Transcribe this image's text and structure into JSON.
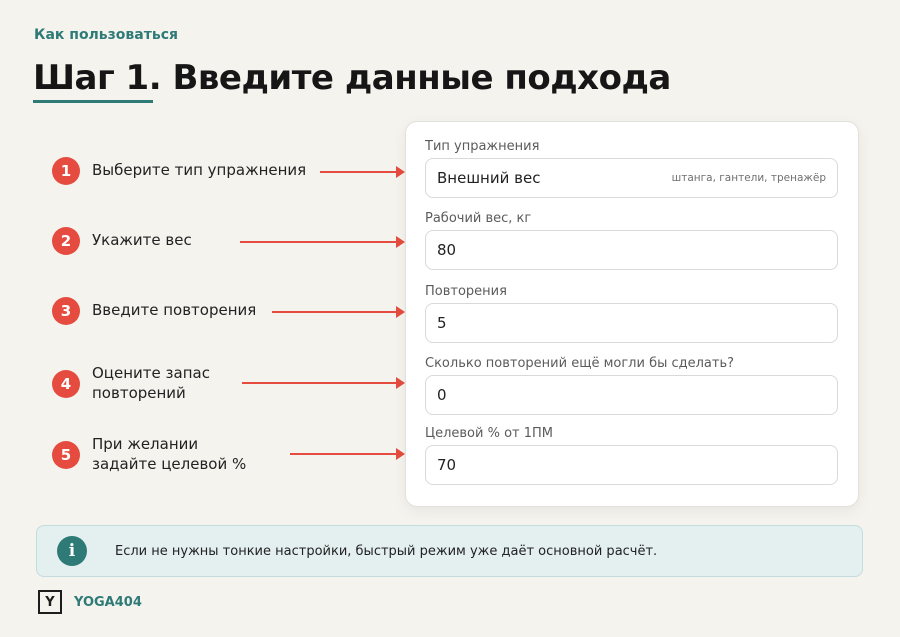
{
  "header": {
    "eyebrow": "Как пользоваться",
    "title": "Шаг 1. Введите данные подхода"
  },
  "steps": [
    {
      "number": "1",
      "text": "Выберите тип упражнения"
    },
    {
      "number": "2",
      "text": "Укажите вес"
    },
    {
      "number": "3",
      "text": "Введите повторения"
    },
    {
      "number": "4",
      "text": "Оцените запас повторений"
    },
    {
      "number": "5",
      "text": "При желании задайте целевой %"
    }
  ],
  "form": {
    "exercise_type": {
      "label": "Тип упражнения",
      "value": "Внешний вес",
      "hint": "штанга, гантели, тренажёр"
    },
    "weight": {
      "label": "Рабочий вес, кг",
      "value": "80"
    },
    "reps": {
      "label": "Повторения",
      "value": "5"
    },
    "reps_in_reserve": {
      "label": "Сколько повторений ещё могли бы сделать?",
      "value": "0"
    },
    "target_percent": {
      "label": "Целевой % от 1ПМ",
      "value": "70"
    }
  },
  "info": {
    "icon": "info-icon",
    "icon_glyph": "i",
    "text": "Если не нужны тонкие настройки, быстрый режим уже даёт основной расчёт."
  },
  "footer": {
    "logo_glyph": "Y",
    "brand": "YOGA404"
  },
  "colors": {
    "accent": "#2e7a77",
    "step_badge": "#e54b3f",
    "arrow": "#e54b3f",
    "background": "#f5f3ee"
  }
}
